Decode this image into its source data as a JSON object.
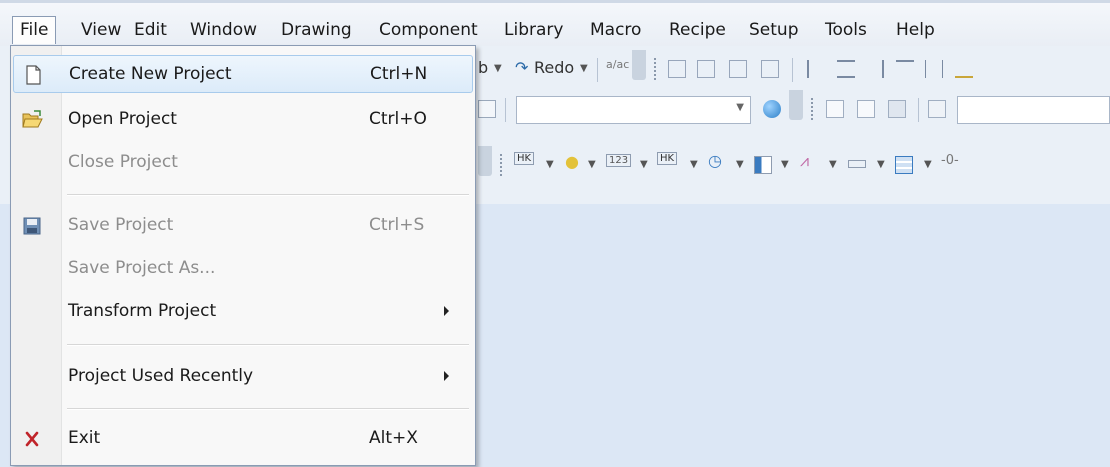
{
  "menubar": {
    "items": [
      "File",
      "View",
      "Edit",
      "Window",
      "Drawing",
      "Component",
      "Library",
      "Macro",
      "Recipe",
      "Setup",
      "Tools",
      "Help"
    ]
  },
  "toolbar": {
    "redo_label": "Redo",
    "number_label": "123",
    "hk_label": "HK"
  },
  "file_menu": {
    "items": [
      {
        "label": "Create New Project",
        "shortcut": "Ctrl+N",
        "icon": "new-document-icon",
        "enabled": true,
        "highlighted": true
      },
      {
        "label": "Open Project",
        "shortcut": "Ctrl+O",
        "icon": "open-folder-icon",
        "enabled": true
      },
      {
        "label": "Close Project",
        "shortcut": "",
        "enabled": false
      },
      {
        "label": "Save Project",
        "shortcut": "Ctrl+S",
        "icon": "save-disk-icon",
        "enabled": false
      },
      {
        "label": "Save Project As...",
        "shortcut": "",
        "enabled": false
      },
      {
        "label": "Transform Project",
        "shortcut": "",
        "submenu": true,
        "enabled": true
      },
      {
        "label": "Project Used Recently",
        "shortcut": "",
        "submenu": true,
        "enabled": true
      },
      {
        "label": "Exit",
        "shortcut": "Alt+X",
        "icon": "exit-x-icon",
        "enabled": true
      }
    ]
  },
  "colors": {
    "highlight_border": "#a8cbec",
    "canvas": "#dce7f5",
    "disabled_text": "#8d8d8d"
  }
}
